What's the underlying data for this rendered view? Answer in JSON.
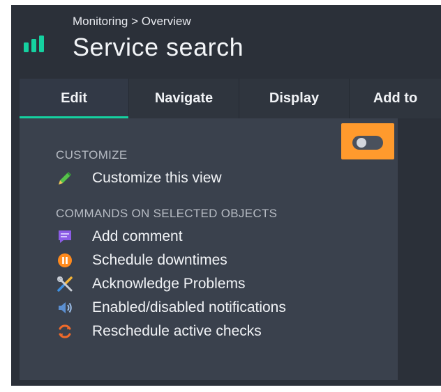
{
  "header": {
    "breadcrumb": "Monitoring > Overview",
    "title": "Service search",
    "logo_icon": "bar-chart-logo-icon",
    "logo_color": "#15d1a0"
  },
  "tabs": [
    {
      "label": "Edit",
      "active": true
    },
    {
      "label": "Navigate",
      "active": false
    },
    {
      "label": "Display",
      "active": false
    },
    {
      "label": "Add to",
      "active": false
    }
  ],
  "toggle": {
    "state": "off",
    "highlight_color": "#ff9a2d"
  },
  "customize": {
    "heading": "CUSTOMIZE",
    "items": [
      {
        "label": "Customize this view",
        "icon": "pencil-icon"
      }
    ]
  },
  "commands": {
    "heading": "COMMANDS ON SELECTED OBJECTS",
    "items": [
      {
        "label": "Add comment",
        "icon": "comment-icon"
      },
      {
        "label": "Schedule downtimes",
        "icon": "pause-icon"
      },
      {
        "label": "Acknowledge Problems",
        "icon": "tools-icon"
      },
      {
        "label": "Enabled/disabled notifications",
        "icon": "speaker-icon"
      },
      {
        "label": "Reschedule active checks",
        "icon": "refresh-icon"
      }
    ]
  }
}
